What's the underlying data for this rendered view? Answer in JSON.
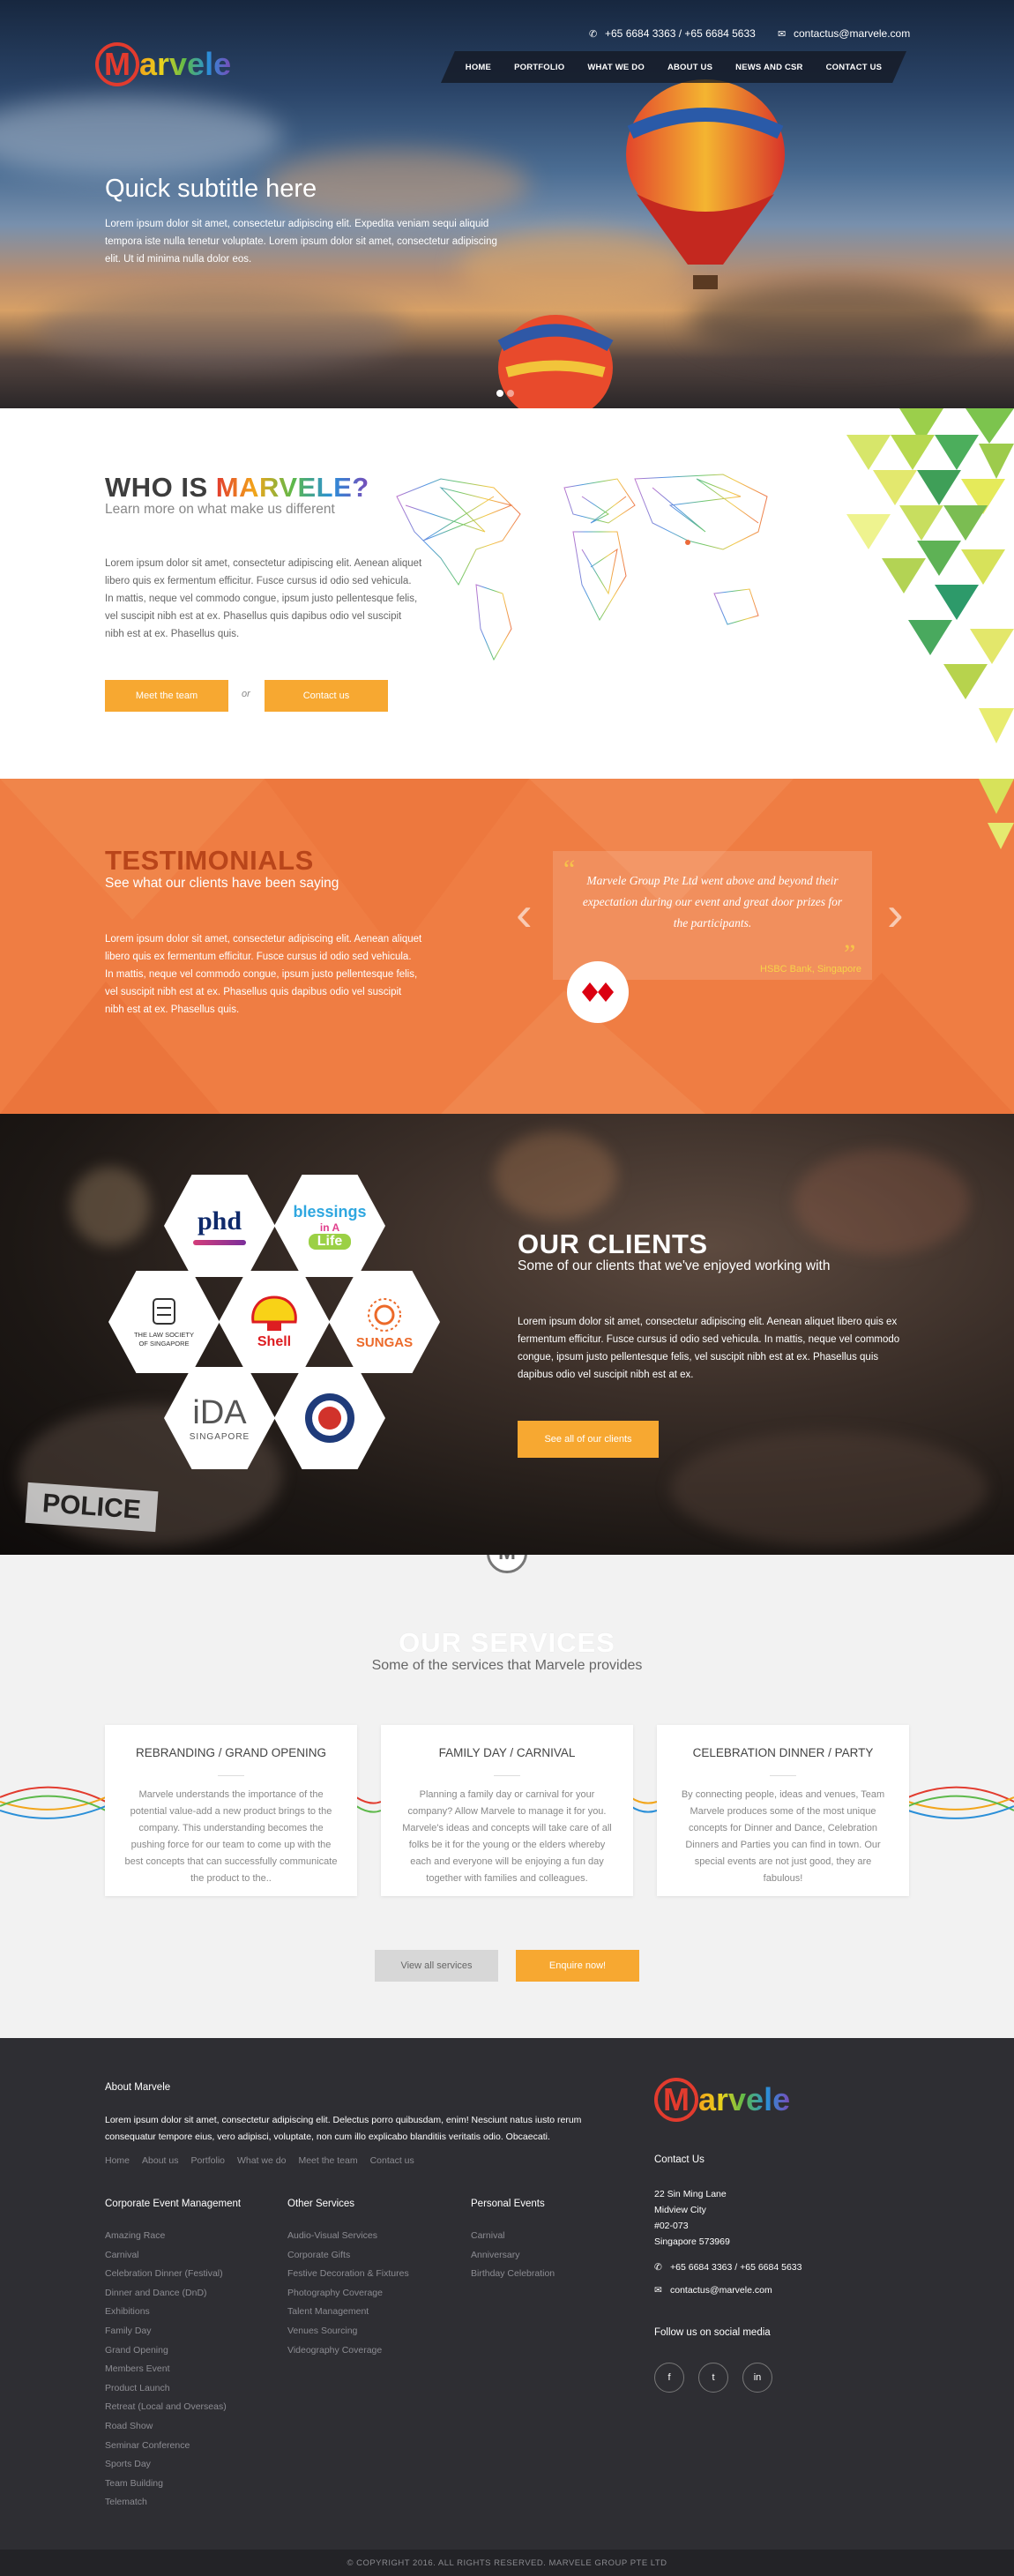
{
  "brand": {
    "logo_m": "M",
    "logo_rest": "arvele"
  },
  "header": {
    "phone": "+65 6684 3363 / +65 6684 5633",
    "email": "contactus@marvele.com",
    "nav": [
      "HOME",
      "PORTFOLIO",
      "WHAT WE DO",
      "ABOUT US",
      "NEWS AND CSR",
      "CONTACT US"
    ]
  },
  "hero": {
    "title": "Quick subtitle here",
    "text": "Lorem ipsum dolor sit amet, consectetur adipiscing elit. Expedita veniam sequi aliquid tempora iste nulla tenetur voluptate. Lorem ipsum dolor sit amet, consectetur adipiscing elit. Ut id minima nulla dolor eos."
  },
  "who": {
    "title_a": "WHO IS ",
    "title_b": "MARVELE?",
    "subtitle": "Learn more on what make us different",
    "text": "Lorem ipsum dolor sit amet, consectetur adipiscing elit. Aenean aliquet libero quis ex fermentum efficitur. Fusce cursus id odio sed vehicula. In mattis, neque vel commodo congue, ipsum justo pellentesque felis, vel suscipit nibh est at ex. Phasellus quis dapibus odio vel suscipit nibh est at ex. Phasellus quis.",
    "btn_team": "Meet the team",
    "or": "or",
    "btn_contact": "Contact us"
  },
  "testimonials": {
    "title": "TESTIMONIALS",
    "subtitle": "See what our clients have been saying",
    "text": "Lorem ipsum dolor sit amet, consectetur adipiscing elit. Aenean aliquet libero quis ex fermentum efficitur. Fusce cursus id odio sed vehicula. In mattis, neque vel commodo congue, ipsum justo pellentesque felis, vel suscipit nibh est at ex. Phasellus quis dapibus odio vel suscipit nibh est at ex. Phasellus quis.",
    "quote": "Marvele Group Pte Ltd went above and beyond their expectation during our event and great door prizes for the participants.",
    "author": "HSBC Bank, Singapore",
    "open_quote": "“",
    "close_quote": "”",
    "prev": "‹",
    "next": "›"
  },
  "clients": {
    "title": "OUR CLIENTS",
    "subtitle": "Some of our clients that we've enjoyed working with",
    "text": "Lorem ipsum dolor sit amet, consectetur adipiscing elit. Aenean aliquet libero quis ex fermentum efficitur. Fusce cursus id odio sed vehicula. In mattis, neque vel commodo congue, ipsum justo pellentesque felis, vel suscipit nibh est at ex. Phasellus quis dapibus odio vel suscipit nibh est at ex.",
    "button": "See all of our clients",
    "logos": {
      "phd": "phd",
      "blessings": "blessings",
      "in_a": "in A",
      "life": "Life",
      "law": "THE LAW SOCIETY OF SINGAPORE",
      "shell": "Shell",
      "sungas": "SUNGAS",
      "ida": "iDA",
      "ida_sub": "SINGAPORE"
    },
    "police": "POLICE"
  },
  "services": {
    "title": "OUR SERVICES",
    "subtitle": "Some of the services that Marvele provides",
    "cards": [
      {
        "title": "REBRANDING / GRAND OPENING",
        "text": "Marvele understands the importance of the potential value-add a new product brings to the company. This understanding becomes the pushing force for our team to come up with the best concepts that can successfully communicate the product to the.."
      },
      {
        "title": "FAMILY DAY / CARNIVAL",
        "text": "Planning a family day or carnival for your company? Allow Marvele to manage it for you. Marvele's ideas and concepts will take care of all folks be it for the young or the elders whereby each and everyone will be enjoying a fun day together with families and colleagues."
      },
      {
        "title": "CELEBRATION DINNER / PARTY",
        "text": "By connecting people, ideas and venues, Team Marvele produces some of the most unique concepts for Dinner and Dance, Celebration Dinners and Parties you can find in town. Our special events are not just good, they are fabulous!"
      }
    ],
    "btn_view": "View all services",
    "btn_enquire": "Enquire now!"
  },
  "footer": {
    "about_title": "About Marvele",
    "about_text": "Lorem ipsum dolor sit amet, consectetur adipiscing elit. Delectus porro quibusdam, enim! Nesciunt natus iusto rerum consequatur tempore eius, vero adipisci, voluptate, non cum illo explicabo blanditiis veritatis odio. Obcaecati.",
    "links": [
      "Home",
      "About us",
      "Portfolio",
      "What we do",
      "Meet the team",
      "Contact us"
    ],
    "col1_title": "Corporate Event Management",
    "col1": [
      "Amazing Race",
      "Carnival",
      "Celebration Dinner (Festival)",
      "Dinner and Dance (DnD)",
      "Exhibitions",
      "Family Day",
      "Grand Opening",
      "Members Event",
      "Product Launch",
      "Retreat (Local and Overseas)",
      "Road Show",
      "Seminar Conference",
      "Sports Day",
      "Team Building",
      "Telematch"
    ],
    "col2_title": "Other Services",
    "col2": [
      "Audio-Visual Services",
      "Corporate Gifts",
      "Festive Decoration & Fixtures",
      "Photography Coverage",
      "Talent Management",
      "Venues Sourcing",
      "Videography Coverage"
    ],
    "col3_title": "Personal Events",
    "col3": [
      "Carnival",
      "Anniversary",
      "Birthday Celebration"
    ],
    "contact_title": "Contact Us",
    "address": [
      "22 Sin Ming Lane",
      "Midview City",
      "#02-073",
      "Singapore 573969"
    ],
    "phone": "+65 6684 3363 / +65 6684 5633",
    "email": "contactus@marvele.com",
    "social_title": "Follow us on social media",
    "social": [
      "f",
      "t",
      "in"
    ],
    "copyright": "© COPYRIGHT 2016. ALL RIGHTS RESERVED. MARVELE GROUP PTE LTD"
  },
  "colors": {
    "accent": "#f7a831",
    "orange_section": "#ef7d43",
    "footer": "#2e2e33",
    "logo_red": "#e23b2e"
  }
}
